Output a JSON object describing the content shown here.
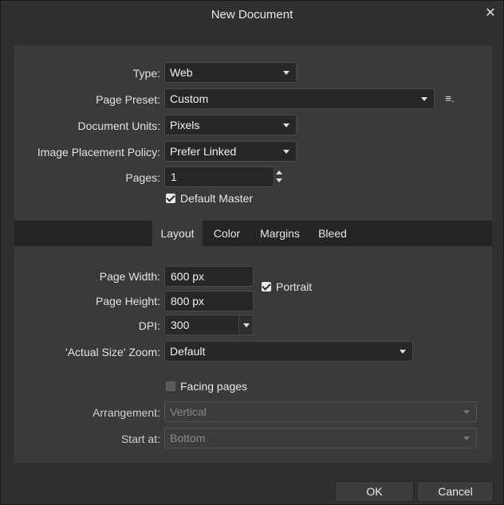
{
  "window": {
    "title": "New Document",
    "close_glyph": "✕"
  },
  "general": {
    "type": {
      "label": "Type:",
      "value": "Web"
    },
    "page_preset": {
      "label": "Page Preset:",
      "value": "Custom",
      "menu_glyph": "≡."
    },
    "document_units": {
      "label": "Document Units:",
      "value": "Pixels"
    },
    "image_placement": {
      "label": "Image Placement Policy:",
      "value": "Prefer Linked"
    },
    "pages": {
      "label": "Pages:",
      "value": "1"
    },
    "default_master": {
      "label": "Default Master",
      "checked": true
    }
  },
  "tabs": [
    {
      "label": "Layout",
      "active": true
    },
    {
      "label": "Color",
      "active": false
    },
    {
      "label": "Margins",
      "active": false
    },
    {
      "label": "Bleed",
      "active": false
    }
  ],
  "layout": {
    "page_width": {
      "label": "Page Width:",
      "value": "600 px"
    },
    "page_height": {
      "label": "Page Height:",
      "value": "800 px"
    },
    "portrait": {
      "label": "Portrait",
      "checked": true
    },
    "dpi": {
      "label": "DPI:",
      "value": "300"
    },
    "actual_size_zoom": {
      "label": "'Actual Size' Zoom:",
      "value": "Default"
    },
    "facing_pages": {
      "label": "Facing pages",
      "checked": false
    },
    "arrangement": {
      "label": "Arrangement:",
      "value": "Vertical",
      "disabled": true
    },
    "start_at": {
      "label": "Start at:",
      "value": "Bottom",
      "disabled": true
    }
  },
  "footer": {
    "ok_label": "OK",
    "cancel_label": "Cancel"
  },
  "colors": {
    "background": "#303030",
    "panel": "#3a3a3a",
    "tab_bar": "#242424",
    "field": "#272727"
  }
}
